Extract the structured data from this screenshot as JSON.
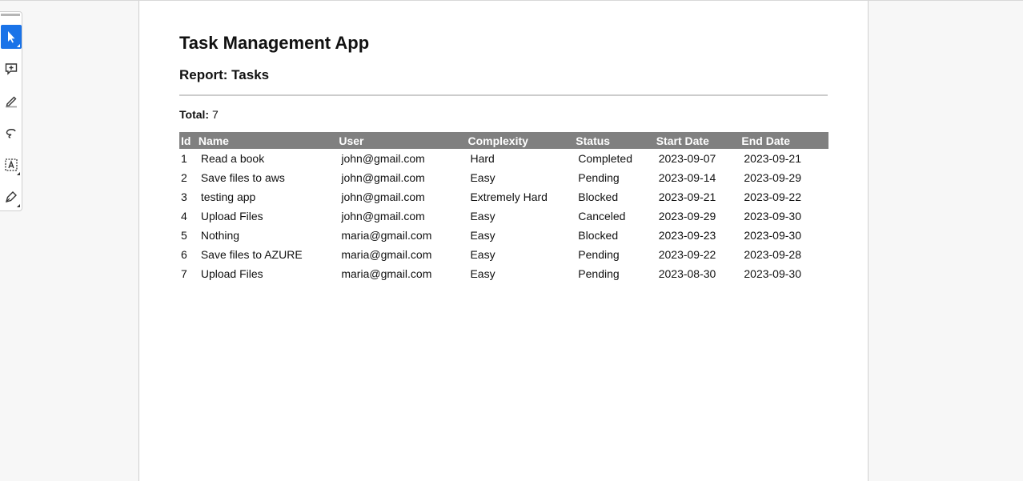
{
  "toolbar": {
    "tools": [
      {
        "name": "select-tool",
        "icon": "cursor-arrow-icon",
        "active": true
      },
      {
        "name": "add-comment-tool",
        "icon": "comment-plus-icon",
        "active": false
      },
      {
        "name": "highlight-tool",
        "icon": "highlighter-icon",
        "active": false
      },
      {
        "name": "draw-tool",
        "icon": "freehand-draw-icon",
        "active": false
      },
      {
        "name": "text-box-tool",
        "icon": "text-box-icon",
        "active": false
      },
      {
        "name": "sign-tool",
        "icon": "pen-sign-icon",
        "active": false
      }
    ]
  },
  "document": {
    "title": "Task Management App",
    "subtitle": "Report: Tasks",
    "total_label": "Total:",
    "total_value": "7",
    "table": {
      "headers": [
        "Id",
        "Name",
        "User",
        "Complexity",
        "Status",
        "Start Date",
        "End Date"
      ],
      "rows": [
        [
          "1",
          "Read a book",
          "john@gmail.com",
          "Hard",
          "Completed",
          "2023-09-07",
          "2023-09-21"
        ],
        [
          "2",
          "Save files to aws",
          "john@gmail.com",
          "Easy",
          "Pending",
          "2023-09-14",
          "2023-09-29"
        ],
        [
          "3",
          "testing app",
          "john@gmail.com",
          "Extremely Hard",
          "Blocked",
          "2023-09-21",
          "2023-09-22"
        ],
        [
          "4",
          "Upload Files",
          "john@gmail.com",
          "Easy",
          "Canceled",
          "2023-09-29",
          "2023-09-30"
        ],
        [
          "5",
          "Nothing",
          "maria@gmail.com",
          "Easy",
          "Blocked",
          "2023-09-23",
          "2023-09-30"
        ],
        [
          "6",
          "Save files to AZURE",
          "maria@gmail.com",
          "Easy",
          "Pending",
          "2023-09-22",
          "2023-09-28"
        ],
        [
          "7",
          "Upload Files",
          "maria@gmail.com",
          "Easy",
          "Pending",
          "2023-08-30",
          "2023-09-30"
        ]
      ]
    }
  },
  "colors": {
    "accent": "#1a73e8",
    "table_header_bg": "#808080",
    "table_header_text": "#ffffff"
  }
}
